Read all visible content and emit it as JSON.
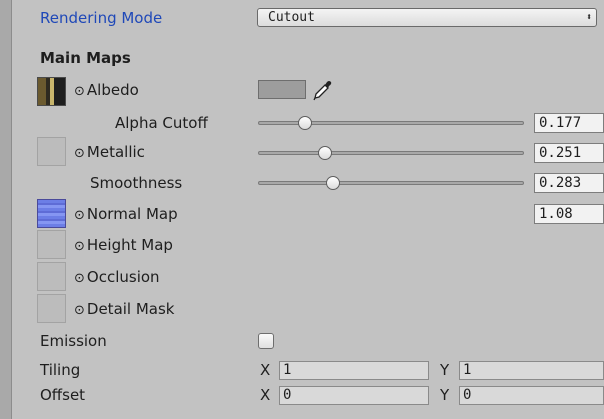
{
  "rendering_mode": {
    "label": "Rendering Mode",
    "value": "Cutout",
    "arrows": "⬍"
  },
  "main_maps": {
    "heading": "Main Maps",
    "albedo": {
      "label": "Albedo",
      "target_icon": "⊙",
      "color": "#9d9d9d"
    },
    "alpha_cutoff": {
      "label": "Alpha Cutoff",
      "value": "0.177",
      "level": 0.177
    },
    "metallic": {
      "label": "Metallic",
      "target_icon": "⊙",
      "value": "0.251",
      "level": 0.251
    },
    "smoothness": {
      "label": "Smoothness",
      "value": "0.283",
      "level": 0.283
    },
    "normal_map": {
      "label": "Normal Map",
      "target_icon": "⊙",
      "value": "1.08"
    },
    "height_map": {
      "label": "Height Map",
      "target_icon": "⊙"
    },
    "occlusion": {
      "label": "Occlusion",
      "target_icon": "⊙"
    },
    "detail_mask": {
      "label": "Detail Mask",
      "target_icon": "⊙"
    }
  },
  "emission": {
    "label": "Emission",
    "checked": false
  },
  "tiling": {
    "label": "Tiling",
    "x_label": "X",
    "x": "1",
    "y_label": "Y",
    "y": "1"
  },
  "offset": {
    "label": "Offset",
    "x_label": "X",
    "x": "0",
    "y_label": "Y",
    "y": "0"
  }
}
